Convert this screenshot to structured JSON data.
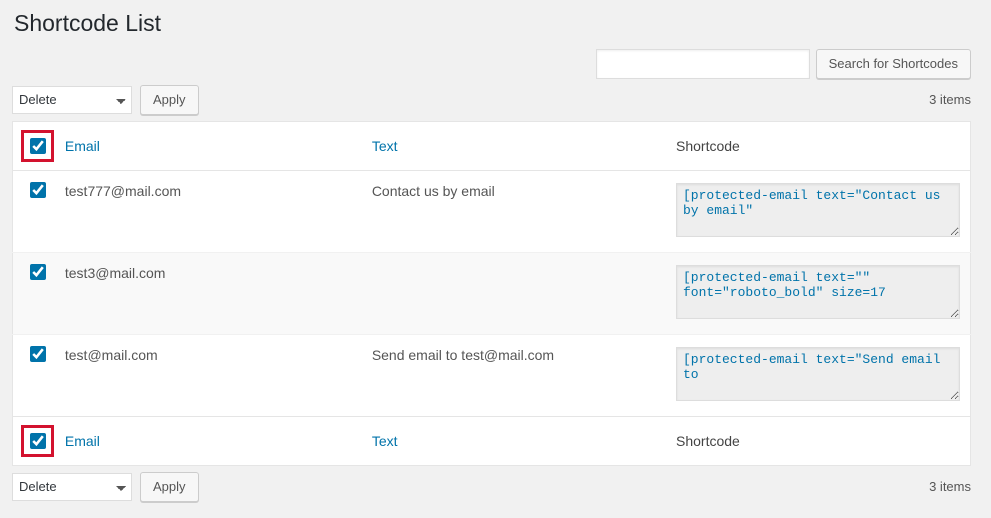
{
  "title": "Shortcode List",
  "search": {
    "placeholder": "",
    "button": "Search for Shortcodes"
  },
  "bulk": {
    "selected": "Delete",
    "options": [
      "Delete"
    ],
    "apply": "Apply"
  },
  "count": "3 items",
  "columns": {
    "email": "Email",
    "text": "Text",
    "shortcode": "Shortcode"
  },
  "rows": [
    {
      "email": "test777@mail.com",
      "text": "Contact us by email",
      "shortcode": "[protected-email text=\"Contact us by email\""
    },
    {
      "email": "test3@mail.com",
      "text": "",
      "shortcode": "[protected-email text=\"\" font=\"roboto_bold\" size=17"
    },
    {
      "email": "test@mail.com",
      "text": "Send email to test@mail.com",
      "shortcode": "[protected-email text=\"Send email to"
    }
  ]
}
